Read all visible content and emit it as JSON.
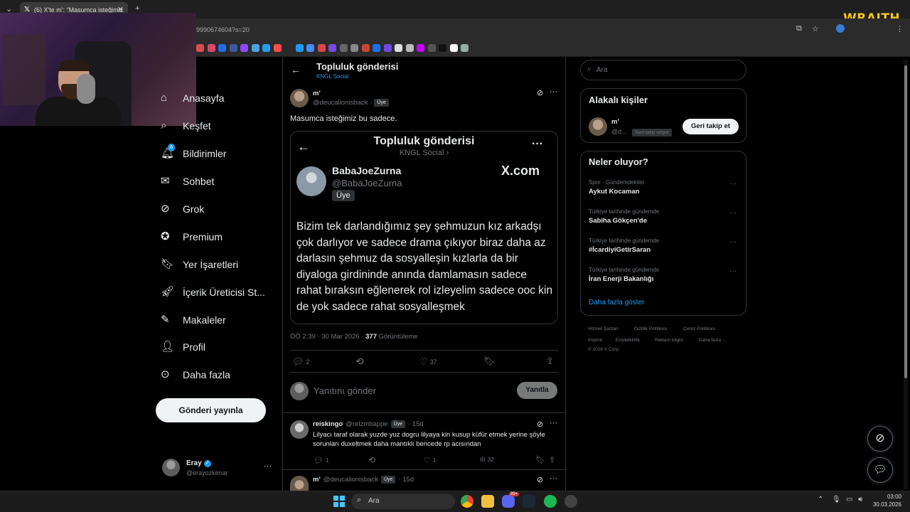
{
  "browser": {
    "tab_title": "(6) X'te m': \"Masumca isteğimiz",
    "url": "9990674604?s=20",
    "overlay_logo": "WRAITH"
  },
  "nav": {
    "items": [
      {
        "label": "Anasayfa",
        "icon": "home-icon"
      },
      {
        "label": "Keşfet",
        "icon": "search-icon"
      },
      {
        "label": "Bildirimler",
        "icon": "bell-icon",
        "badge": "6"
      },
      {
        "label": "Sohbet",
        "icon": "mail-icon"
      },
      {
        "label": "Grok",
        "icon": "grok-icon"
      },
      {
        "label": "Premium",
        "icon": "premium-icon"
      },
      {
        "label": "Yer İşaretleri",
        "icon": "bookmark-icon"
      },
      {
        "label": "İçerik Üreticisi St...",
        "icon": "rocket-icon"
      },
      {
        "label": "Makaleler",
        "icon": "article-icon"
      },
      {
        "label": "Profil",
        "icon": "person-icon"
      },
      {
        "label": "Daha fazla",
        "icon": "more-circle-icon"
      }
    ],
    "post_button": "Gönderi yayınla",
    "account": {
      "name": "Eray",
      "handle": "@erayozkenar"
    }
  },
  "header": {
    "title": "Topluluk gönderisi",
    "subtitle": "KNGL Social"
  },
  "post": {
    "author": "m'",
    "handle": "@deucalionisback",
    "handle_sep": "·",
    "member_badge": "Üye",
    "text": "Masumca isteğimiz bu sadece.",
    "quote": {
      "title": "Topluluk gönderisi",
      "subtitle": "KNGL Social ›",
      "author": "BabaJoeZurna",
      "handle": "@BabaJoeZurna",
      "badge": "Üye",
      "watermark": "X.com",
      "body": "Bizim tek darlandığımız şey şehmuzun kız arkadşı çok darlıyor ve sadece drama çıkıyor biraz daha az darlasın şehmuz da sosyalleşin kızlarla da bir diyaloga girdininde anında damlamasın sadece rahat bıraksın eğlenerek rol izleyelim sadece ooc kin de yok sadece rahat sosyalleşmek"
    },
    "timestamp": "ÖÖ 2:39 · 30 Mar 2026 · ",
    "views_count": "377",
    "views_label": " Görüntüleme",
    "replies": "2",
    "likes": "37",
    "reply_placeholder": "Yanıtını gönder",
    "reply_button": "Yanıtla"
  },
  "replies": [
    {
      "author": "reiskingo",
      "handle": "@relzmbappe",
      "badge": "Üye",
      "age": "· 15d",
      "text": "Lilyacı taraf olarak yuzde yuz dogru lilyaya kin kusup küfür etmek yerine şöyle sorunları duxeltmek daha mantıklı bencede rp acısından",
      "replies": "1",
      "likes": "1",
      "views": "32"
    },
    {
      "author": "m'",
      "handle": "@deucalionisback",
      "badge": "Üye",
      "age": "· 15d"
    }
  ],
  "sidebar": {
    "search_placeholder": "Ara",
    "related_title": "Alakalı kişiler",
    "related_person": {
      "name": "m'",
      "handle": "@d...",
      "note": "Seni takip ediyor",
      "button": "Geri takip et"
    },
    "trends_title": "Neler oluyor?",
    "trends": [
      {
        "category": "Spor · Gündemdekiler",
        "name": "Aykut Kocaman"
      },
      {
        "category": "Türkiye tarihinde gündemde",
        "name": "Sabiha Gökçen'de"
      },
      {
        "category": "Türkiye tarihinde gündemde",
        "name": "#İcardiyiGetirSaran"
      },
      {
        "category": "Türkiye tarihinde gündemde",
        "name": "İran Enerji Bakanlığı"
      }
    ],
    "show_more": "Daha fazla göster",
    "footer": {
      "links": [
        "Hizmet Şartları",
        "Gizlilik Politikası",
        "Çerez Politikası",
        "Imprint",
        "Erişilebilirlik",
        "Reklam bilgisi",
        "Daha fazla ..."
      ],
      "copyright": "© 2026 X Corp."
    }
  },
  "taskbar": {
    "search_placeholder": "Ara",
    "discord_badge": "99+",
    "time": "03:00",
    "date": "30.03.2026"
  },
  "colors": {
    "background": "#000000",
    "link": "#1d9bf0",
    "muted": "#71767b",
    "text": "#e7e9ea"
  }
}
